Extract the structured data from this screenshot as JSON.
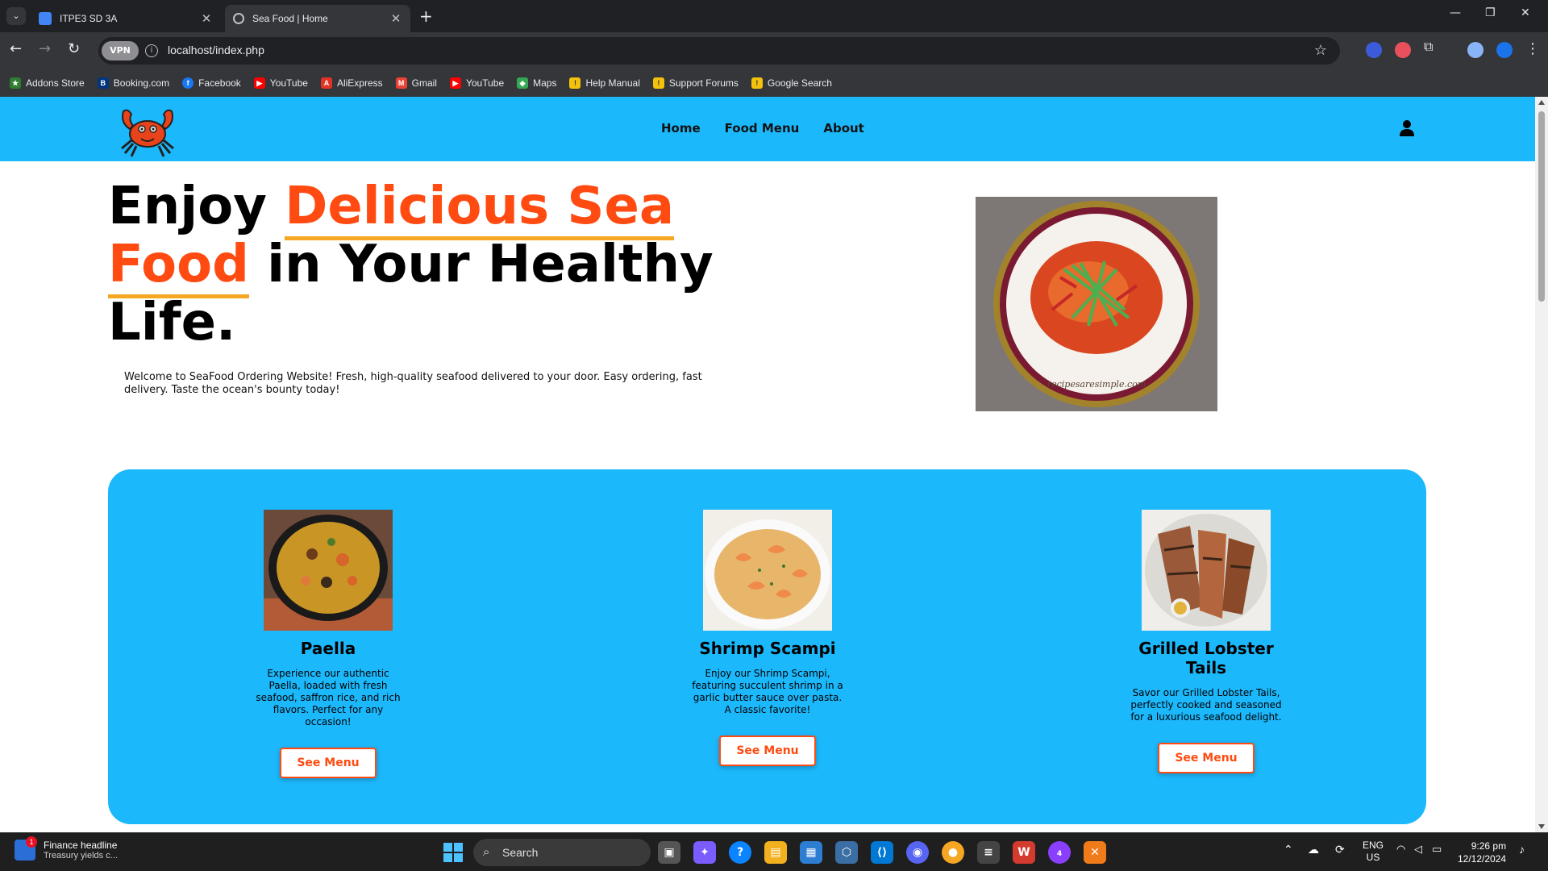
{
  "browser": {
    "tabs": [
      {
        "title": "ITPE3 SD 3A",
        "active": false
      },
      {
        "title": "Sea Food | Home",
        "active": true
      }
    ],
    "new_tab_label": "+",
    "vpn_label": "VPN",
    "url": "localhost/index.php",
    "bookmarks": [
      {
        "label": "Addons Store",
        "icon": "addons-store-icon",
        "color": "#2e7d32"
      },
      {
        "label": "Booking.com",
        "icon": "booking-icon",
        "color": "#003580",
        "glyph": "B."
      },
      {
        "label": "Facebook",
        "icon": "facebook-icon",
        "color": "#1877f2",
        "glyph": "f"
      },
      {
        "label": "YouTube",
        "icon": "youtube-icon",
        "color": "#ff0000",
        "glyph": "▶"
      },
      {
        "label": "AliExpress",
        "icon": "aliexpress-icon",
        "color": "#e43225",
        "glyph": "A"
      },
      {
        "label": "Gmail",
        "icon": "gmail-icon",
        "color": "#ea4335",
        "glyph": "M"
      },
      {
        "label": "YouTube",
        "icon": "youtube-icon",
        "color": "#ff0000",
        "glyph": "▶"
      },
      {
        "label": "Maps",
        "icon": "maps-icon",
        "color": "#34a853",
        "glyph": "◆"
      },
      {
        "label": "Help Manual",
        "icon": "help-manual-icon",
        "color": "#f4c20d",
        "glyph": "!"
      },
      {
        "label": "Support Forums",
        "icon": "support-forums-icon",
        "color": "#f4c20d",
        "glyph": "!"
      },
      {
        "label": "Google Search",
        "icon": "google-search-icon",
        "color": "#f4c20d",
        "glyph": "!"
      }
    ]
  },
  "site": {
    "nav": {
      "home": "Home",
      "food_menu": "Food Menu",
      "about": "About"
    },
    "hero": {
      "title_1": "Enjoy ",
      "title_highlight_1": "Delicious Sea",
      "title_2": " ",
      "title_highlight_2": "Food",
      "title_3": " in Your Healthy Life.",
      "description": "Welcome to SeaFood Ordering Website! Fresh, high-quality seafood delivered to your door. Easy ordering, fast delivery. Taste the ocean's bounty today!",
      "image_watermark": "recipesaresimple.com"
    },
    "dishes": [
      {
        "name": "Paella",
        "description": "Experience our authentic Paella, loaded with fresh seafood, saffron rice, and rich flavors. Perfect for any occasion!",
        "button": "See Menu"
      },
      {
        "name": "Shrimp Scampi",
        "description": "Enjoy our Shrimp Scampi, featuring succulent shrimp in a garlic butter sauce over pasta. A classic favorite!",
        "button": "See Menu"
      },
      {
        "name": "Grilled Lobster Tails",
        "description": "Savor our Grilled Lobster Tails, perfectly cooked and seasoned for a luxurious seafood delight.",
        "button": "See Menu"
      }
    ],
    "colors": {
      "accent": "#ff4b11",
      "header_bg": "#1cb8fc",
      "underline": "#f5a623"
    }
  },
  "taskbar": {
    "news_title": "Finance headline",
    "news_subtitle": "Treasury yields c...",
    "news_badge": "1",
    "search_placeholder": "Search",
    "language": "ENG",
    "region": "US",
    "time": "9:26 pm",
    "date": "12/12/2024",
    "messenger_badge": "4"
  }
}
